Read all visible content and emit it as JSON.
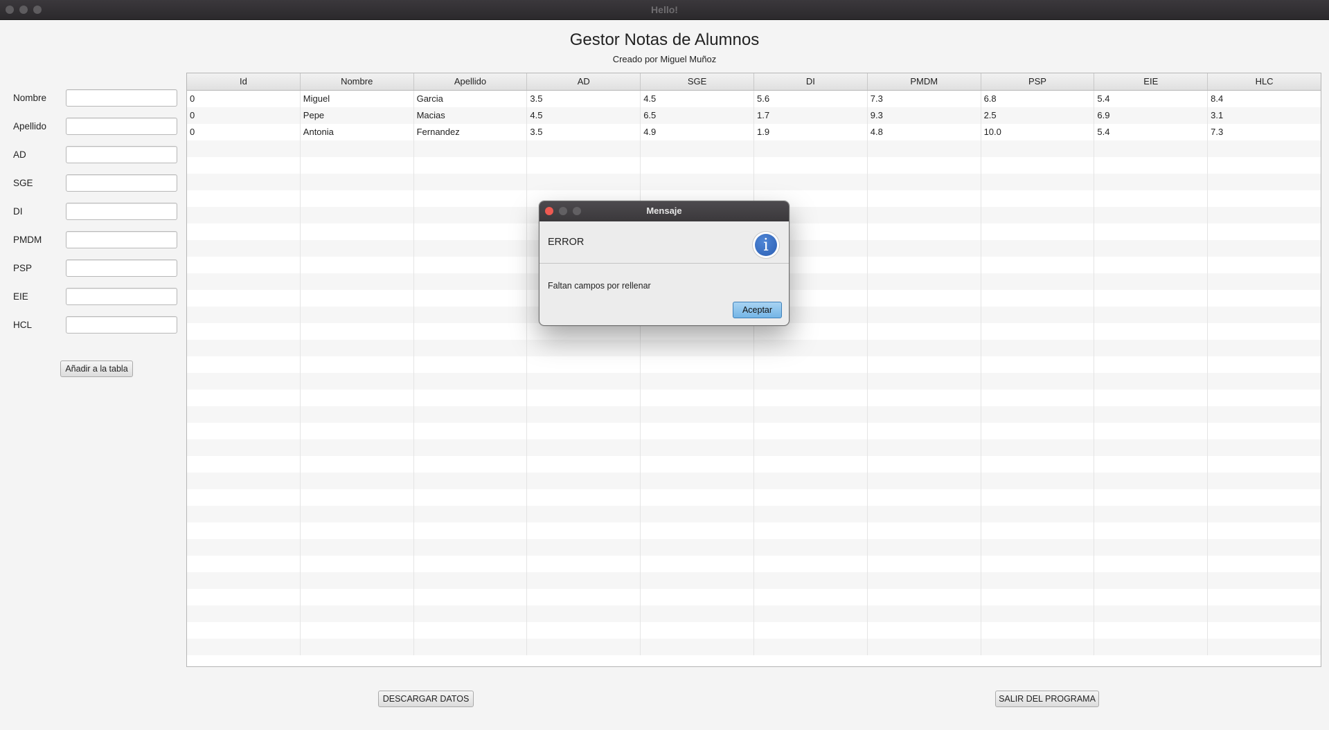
{
  "window": {
    "title": "Hello!"
  },
  "header": {
    "title": "Gestor Notas de Alumnos",
    "subtitle": "Creado por Miguel Muñoz"
  },
  "form": {
    "fields": [
      {
        "label": "Nombre",
        "value": ""
      },
      {
        "label": "Apellido",
        "value": ""
      },
      {
        "label": "AD",
        "value": ""
      },
      {
        "label": "SGE",
        "value": ""
      },
      {
        "label": "DI",
        "value": ""
      },
      {
        "label": "PMDM",
        "value": ""
      },
      {
        "label": "PSP",
        "value": ""
      },
      {
        "label": "EIE",
        "value": ""
      },
      {
        "label": "HCL",
        "value": ""
      }
    ],
    "add_button": "Añadir a la tabla"
  },
  "table": {
    "columns": [
      "Id",
      "Nombre",
      "Apellido",
      "AD",
      "SGE",
      "DI",
      "PMDM",
      "PSP",
      "EIE",
      "HLC"
    ],
    "rows": [
      [
        "0",
        "Miguel",
        "Garcia",
        "3.5",
        "4.5",
        "5.6",
        "7.3",
        "6.8",
        "5.4",
        "8.4"
      ],
      [
        "0",
        "Pepe",
        "Macias",
        "4.5",
        "6.5",
        "1.7",
        "9.3",
        "2.5",
        "6.9",
        "3.1"
      ],
      [
        "0",
        "Antonia",
        "Fernandez",
        "3.5",
        "4.9",
        "1.9",
        "4.8",
        "10.0",
        "5.4",
        "7.3"
      ]
    ]
  },
  "footer": {
    "download_button": "DESCARGAR DATOS",
    "exit_button": "SALIR DEL PROGRAMA"
  },
  "dialog": {
    "title": "Mensaje",
    "header": "ERROR",
    "content": "Faltan campos por rellenar",
    "ok_button": "Aceptar",
    "icon": "info-icon",
    "icon_glyph": "i"
  },
  "colors": {
    "close": "#ee5a52",
    "inactive": "#5e5c5f",
    "accent": "#74b5e6"
  }
}
